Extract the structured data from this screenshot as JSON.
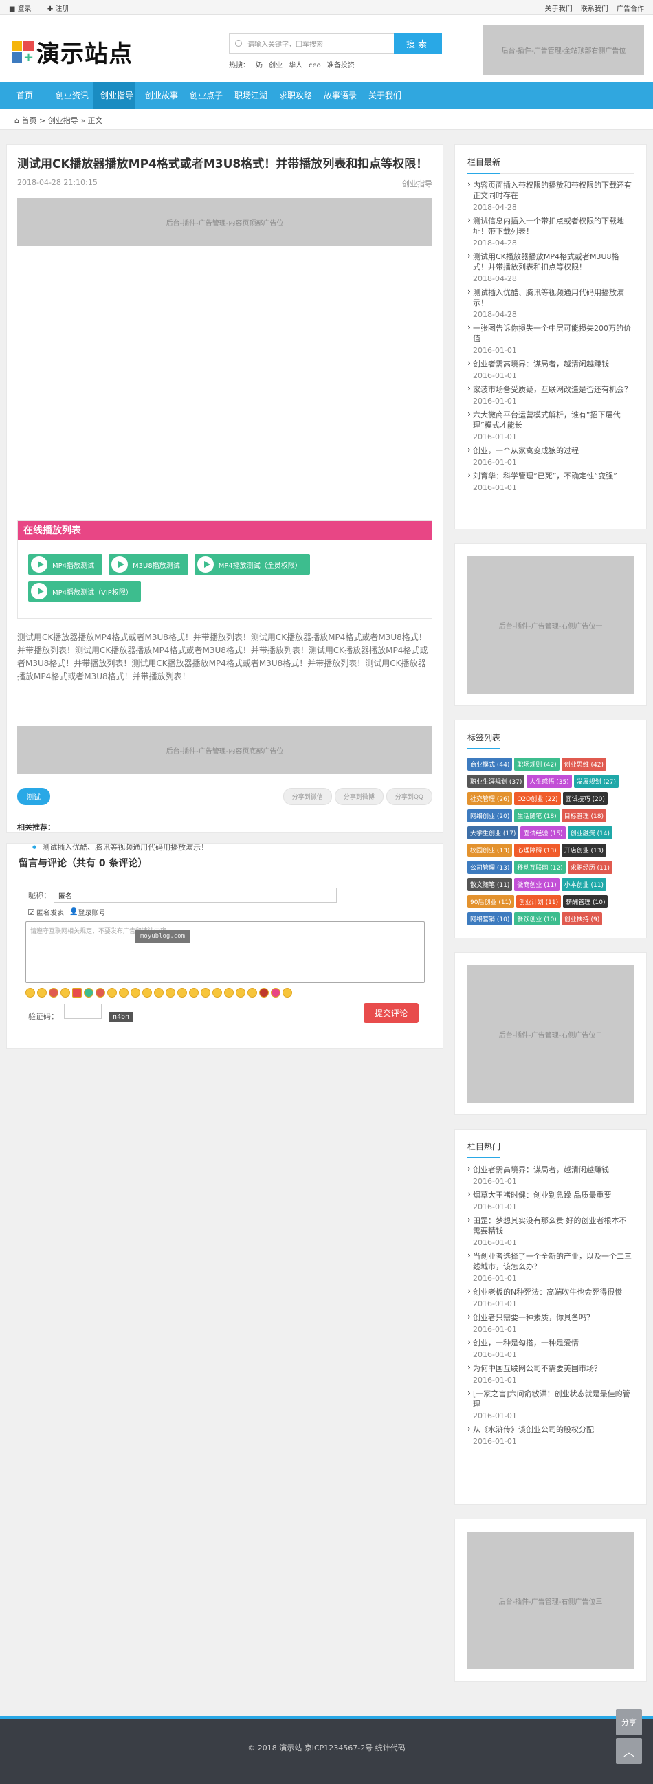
{
  "topbar": {
    "login": "登录",
    "register": "注册",
    "links": [
      "关于我们",
      "联系我们",
      "广告合作"
    ]
  },
  "header": {
    "logo": "演示站点",
    "search_placeholder": "请输入关键字，回车搜索",
    "search_button": "搜索",
    "hot_label": "热搜：",
    "hot_words": [
      "奶",
      "创业",
      "华人",
      "ceo",
      "准备投资"
    ],
    "ad": "后台-插件-广告管理-全站顶部右侧广告位"
  },
  "nav": [
    "首页",
    "创业资讯",
    "创业指导",
    "创业故事",
    "创业点子",
    "职场江湖",
    "求职攻略",
    "故事语录",
    "关于我们"
  ],
  "breadcrumb": {
    "home": "首页",
    "sep": ">",
    "cat": "创业指导",
    "sep2": "»",
    "current": "正文"
  },
  "article": {
    "title": "测试用CK播放器播放MP4格式或者M3U8格式！并带播放列表和扣点等权限！",
    "date": "2018-04-28 21:10:15",
    "category": "创业指导",
    "top_ad": "后台-插件-广告管理-内容页顶部广告位",
    "playlist_title": "在线播放列表",
    "playlist": [
      "MP4播放测试",
      "M3U8播放测试",
      "MP4播放测试（全员权限）",
      "MP4播放测试（VIP权限）"
    ],
    "body": "测试用CK播放器播放MP4格式或者M3U8格式！并带播放列表！测试用CK播放器播放MP4格式或者M3U8格式！并带播放列表！测试用CK播放器播放MP4格式或者M3U8格式！并带播放列表！测试用CK播放器播放MP4格式或者M3U8格式！并带播放列表！测试用CK播放器播放MP4格式或者M3U8格式！并带播放列表！测试用CK播放器播放MP4格式或者M3U8格式！并带播放列表！",
    "bottom_ad": "后台-插件-广告管理-内容页底部广告位",
    "tag": "测试",
    "shares": [
      "分享到微信",
      "分享到微博",
      "分享到QQ"
    ],
    "related_title": "相关推荐：",
    "related": [
      "测试插入优酷、腾讯等视频通用代码用播放演示！"
    ]
  },
  "comment": {
    "title": "留言与评论（共有 0 条评论）",
    "nick_label": "昵称：",
    "nick_value": "匿名",
    "anon_label": "匿名发表",
    "login_label": "登录账号",
    "placeholder": "请遵守互联网相关规定，不要发布广告和违法内容",
    "watermark": "moyublog.com",
    "verify_label": "验证码：",
    "captcha": "n4bn",
    "submit": "提交评论"
  },
  "sidebar": {
    "latest_title": "栏目最新",
    "latest": [
      {
        "t": "内容页面插入带权限的播放和带权限的下载还有正文同时存在",
        "d": "2018-04-28"
      },
      {
        "t": "测试信息内插入一个带扣点或者权限的下载地址！带下载列表！",
        "d": "2018-04-28"
      },
      {
        "t": "测试用CK播放器播放MP4格式或者M3U8格式！并带播放列表和扣点等权限！",
        "d": "2018-04-28"
      },
      {
        "t": "测试插入优酷、腾讯等视频通用代码用播放演示！",
        "d": "2018-04-28"
      },
      {
        "t": "一张图告诉你损失一个中层可能损失200万的价值",
        "d": "2016-01-01"
      },
      {
        "t": "创业者需高境界：谋局者，越清闲越赚钱",
        "d": "2016-01-01"
      },
      {
        "t": "家装市场备受质疑，互联网改造是否还有机会？",
        "d": "2016-01-01"
      },
      {
        "t": "六大微商平台运营模式解析，谁有“招下层代理”模式才能长",
        "d": "2016-01-01"
      },
      {
        "t": "创业，一个从家禽变成狼的过程",
        "d": "2016-01-01"
      },
      {
        "t": "刘育华：科学管理“已死”，不确定性“变强”",
        "d": "2016-01-01"
      }
    ],
    "ad1": "后台-插件-广告管理-右侧广告位一",
    "tags_title": "标签列表",
    "tags": [
      {
        "t": "商业模式 (44)",
        "c": "#3d7bbf"
      },
      {
        "t": "职场规则 (42)",
        "c": "#3dbd8e"
      },
      {
        "t": "创业思维 (42)",
        "c": "#e05a4f"
      },
      {
        "t": "职业生涯规划 (37)",
        "c": "#555555"
      },
      {
        "t": "人生感悟 (35)",
        "c": "#c24fd6"
      },
      {
        "t": "发展规划 (27)",
        "c": "#1fa8a8"
      },
      {
        "t": "社交管理 (26)",
        "c": "#e3922e"
      },
      {
        "t": "O2O创业 (22)",
        "c": "#f05c2b"
      },
      {
        "t": "面试技巧 (20)",
        "c": "#333333"
      },
      {
        "t": "网络创业 (20)",
        "c": "#3d7bbf"
      },
      {
        "t": "生活随笔 (18)",
        "c": "#3dbd8e"
      },
      {
        "t": "目标管理 (18)",
        "c": "#e05a4f"
      },
      {
        "t": "大学生创业 (17)",
        "c": "#3d6fa8"
      },
      {
        "t": "面试经验 (15)",
        "c": "#c24fd6"
      },
      {
        "t": "创业融资 (14)",
        "c": "#1fa8a8"
      },
      {
        "t": "校园创业 (13)",
        "c": "#e3922e"
      },
      {
        "t": "心理障碍 (13)",
        "c": "#f05c2b"
      },
      {
        "t": "开店创业 (13)",
        "c": "#333333"
      },
      {
        "t": "公司管理 (13)",
        "c": "#3d7bbf"
      },
      {
        "t": "移动互联网 (12)",
        "c": "#3dbd8e"
      },
      {
        "t": "求职经历 (11)",
        "c": "#e05a4f"
      },
      {
        "t": "散文随笔 (11)",
        "c": "#555555"
      },
      {
        "t": "微商创业 (11)",
        "c": "#c24fd6"
      },
      {
        "t": "小本创业 (11)",
        "c": "#1fa8a8"
      },
      {
        "t": "90后创业 (11)",
        "c": "#e3922e"
      },
      {
        "t": "创业计划 (11)",
        "c": "#f05c2b"
      },
      {
        "t": "薪酬管理 (10)",
        "c": "#333333"
      },
      {
        "t": "网络营销 (10)",
        "c": "#3d7bbf"
      },
      {
        "t": "餐饮创业 (10)",
        "c": "#3dbd8e"
      },
      {
        "t": "创业扶持 (9)",
        "c": "#e05a4f"
      }
    ],
    "ad2": "后台-插件-广告管理-右侧广告位二",
    "hot_title": "栏目热门",
    "hot": [
      {
        "t": "创业者需高境界：谋局者，越清闲越赚钱",
        "d": "2016-01-01"
      },
      {
        "t": "烟草大王褚时健：创业别急躁 品质最重要",
        "d": "2016-01-01"
      },
      {
        "t": "田罡：梦想其实没有那么贵 好的创业者根本不需要精钱",
        "d": "2016-01-01"
      },
      {
        "t": "当创业者选择了一个全新的产业，以及一个二三线城市，该怎么办？",
        "d": "2016-01-01"
      },
      {
        "t": "创业老板的N种死法：高端吹牛也会死得很惨",
        "d": "2016-01-01"
      },
      {
        "t": "创业者只需要一种素质，你具备吗？",
        "d": "2016-01-01"
      },
      {
        "t": "创业，一种是勾搭，一种是爱情",
        "d": "2016-01-01"
      },
      {
        "t": "为何中国互联网公司不需要美国市场？",
        "d": "2016-01-01"
      },
      {
        "t": "[一家之言]六问俞敏洪：创业状态就是最佳的管理",
        "d": "2016-01-01"
      },
      {
        "t": "从《水浒传》谈创业公司的股权分配",
        "d": "2016-01-01"
      }
    ],
    "ad3": "后台-插件-广告管理-右侧广告位三"
  },
  "footer": {
    "text": "© 2018 演示站   京ICP1234567-2号   统计代码"
  },
  "float": {
    "share": "分享",
    "top": "︿"
  }
}
